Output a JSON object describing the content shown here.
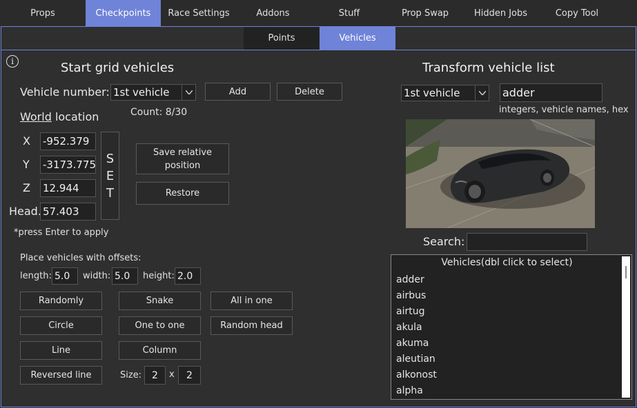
{
  "top_tabs": [
    "Props",
    "Checkpoints",
    "Race Settings",
    "Addons",
    "Stuff",
    "Prop Swap",
    "Hidden Jobs",
    "Copy Tool"
  ],
  "active_top_tab": "Checkpoints",
  "sub_tabs": [
    "Points",
    "Vehicles"
  ],
  "active_sub_tab": "Vehicles",
  "left": {
    "title": "Start grid vehicles",
    "vehicle_number_label": "Vehicle number:",
    "vehicle_number_value": "1st vehicle",
    "add_label": "Add",
    "delete_label": "Delete",
    "world_label": "World",
    "location_label": " location",
    "count_text": "Count: 8/30",
    "x_label": "X",
    "y_label": "Y",
    "z_label": "Z",
    "head_label": "Head.",
    "x_value": "-952.379",
    "y_value": "-3173.775",
    "z_value": "12.944",
    "head_value": "57.403",
    "set_letters": [
      "S",
      "E",
      "T"
    ],
    "save_relative_label": "Save relative position",
    "restore_label": "Restore",
    "hint": "*press Enter to apply",
    "offsets_label": "Place vehicles with offsets:",
    "length_label": "length:",
    "length_value": "5.0",
    "width_label": "width:",
    "width_value": "5.0",
    "height_label": "height:",
    "height_value": "2.0",
    "buttons": {
      "randomly": "Randomly",
      "snake": "Snake",
      "all_in_one": "All in one",
      "circle": "Circle",
      "one_to_one": "One to one",
      "random_head": "Random head",
      "line": "Line",
      "column": "Column",
      "reversed_line": "Reversed line"
    },
    "size_label": "Size:",
    "size_a": "2",
    "size_x": "x",
    "size_b": "2"
  },
  "right": {
    "title": "Transform vehicle list",
    "vehicle_select": "1st vehicle",
    "model_value": "adder",
    "model_hint": "integers, vehicle names, hex",
    "search_label": "Search:",
    "search_value": "",
    "list_header": "Vehicles(dbl click to select)",
    "list_items": [
      "adder",
      "airbus",
      "airtug",
      "akula",
      "akuma",
      "aleutian",
      "alkonost",
      "alpha"
    ]
  },
  "colors": {
    "accent": "#6f83d8",
    "background": "#2f2f2f"
  },
  "icons": {
    "info": "info-icon",
    "dropdown": "chevron-down-icon"
  }
}
